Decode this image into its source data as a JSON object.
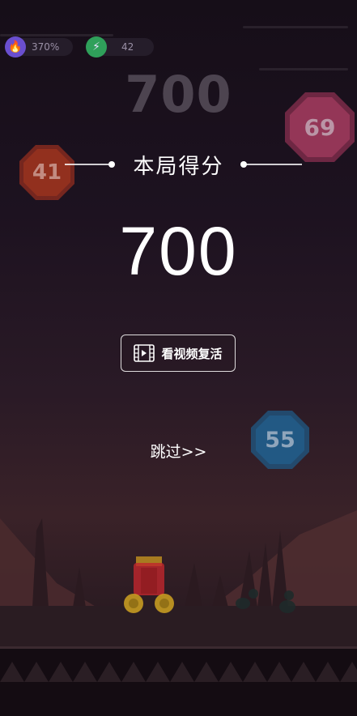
{
  "hud": {
    "power_percent": "370%",
    "power_icon": "flame-icon",
    "coins": "42",
    "coins_icon": "bolt-icon"
  },
  "background_score": "700",
  "enemies": [
    {
      "value": "69",
      "color": "#b23a62"
    },
    {
      "value": "41",
      "color": "#c0391f"
    },
    {
      "value": "55",
      "color": "#1f5a86"
    }
  ],
  "game_over": {
    "title": "本局得分",
    "score": "700",
    "revive_label": "看视频复活",
    "revive_icon": "video-icon",
    "skip_label": "跳过>>"
  },
  "colors": {
    "accent_purple": "#6a4fcf",
    "accent_green": "#2fa05a",
    "cannon_red": "#c0272d",
    "wheel_gold": "#e6b422"
  }
}
